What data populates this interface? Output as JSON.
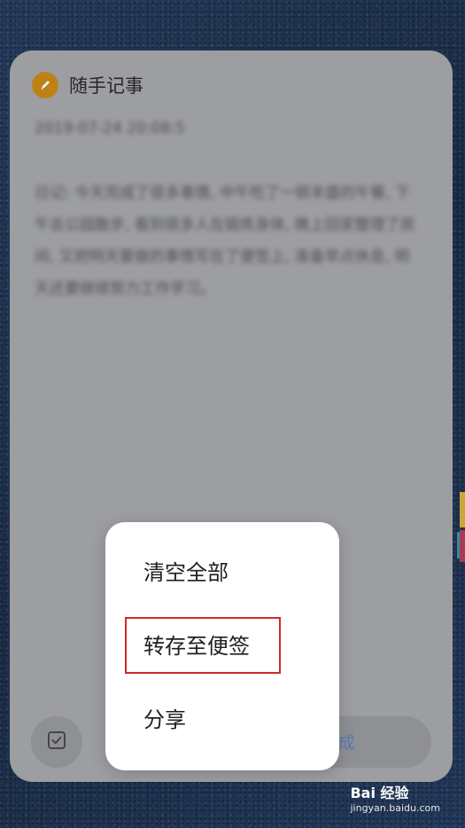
{
  "app": {
    "title": "随手记事",
    "icon": "pencil-icon",
    "accent_color": "#c98a17"
  },
  "note": {
    "date": "2019-07-24 20:08:52",
    "body": "日记: 今天完成了很多事情, 中午吃了一顿丰盛的午餐, 下午去公园散步, 看到很多人在锻炼身体, 晚上回家整理了房间, 又把明天要做的事情写在了便签上, 准备早点休息, 明天还要继续努力工作学习。"
  },
  "bottom_bar": {
    "check_icon": "checkbox-icon",
    "done_label": "完成"
  },
  "context_menu": {
    "items": [
      {
        "label": "清空全部"
      },
      {
        "label": "转存至便签"
      },
      {
        "label": "分享"
      }
    ],
    "highlighted_index": 1,
    "highlight_color": "#d3262a"
  },
  "watermark": {
    "brand": "Bai 经验",
    "url": "jingyan.baidu.com"
  }
}
